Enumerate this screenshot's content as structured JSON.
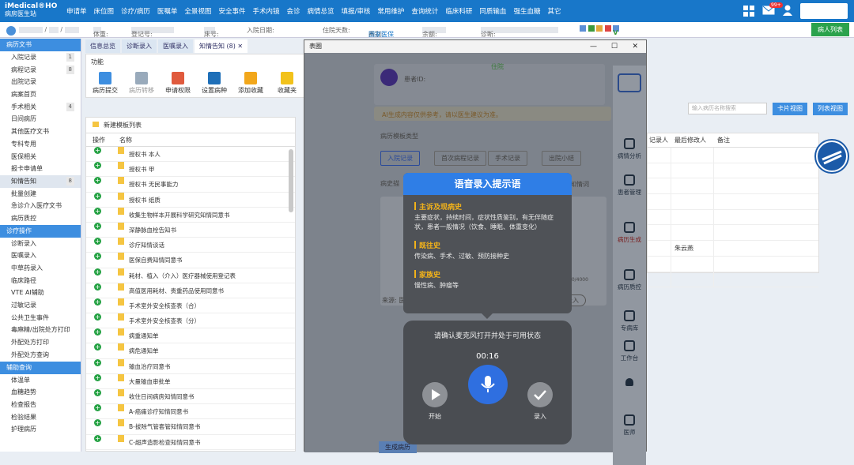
{
  "app": {
    "name_line1": "iMedical",
    "name_suffix": "HO",
    "name_line2": "病房医生站"
  },
  "top_menu": [
    "申请单",
    "床位图",
    "诊疗/病历",
    "医嘱单",
    "全景视图",
    "安全事件",
    "手术内镜",
    "会诊",
    "病情总览",
    "填报/审核",
    "常用维护",
    "查询统计",
    "临床科研",
    "同质输血",
    "强生血糖",
    "其它"
  ],
  "top_icons": {
    "grid": "grid-icon",
    "mail_badge": "99+",
    "user": "user-icon"
  },
  "patient_bar": {
    "weight_label": "体重:",
    "reg_label": "登记号:",
    "bed_label": "床号:",
    "admit_label": "入院日期:",
    "days_label": "住院天数:",
    "fee_label": "费别:",
    "fee_value": "国家医保",
    "balance_label": "余额:",
    "diag_label": "诊断:",
    "list_button": "病人列表"
  },
  "sidebar": {
    "sections": [
      {
        "title": "病历文书",
        "items": [
          {
            "label": "入院记录",
            "count": "1"
          },
          {
            "label": "病程记录",
            "count": "8"
          },
          {
            "label": "出院记录"
          },
          {
            "label": "病案首页"
          },
          {
            "label": "手术相关",
            "count": "4"
          },
          {
            "label": "日间病历"
          },
          {
            "label": "其他医疗文书"
          },
          {
            "label": "专科专用"
          },
          {
            "label": "医保相关"
          },
          {
            "label": "报卡申请单"
          },
          {
            "label": "知情告知",
            "count": "8",
            "active": true
          },
          {
            "label": "批量创建"
          },
          {
            "label": "急诊介入医疗文书"
          },
          {
            "label": "病历质控"
          }
        ]
      },
      {
        "title": "诊疗操作",
        "items": [
          {
            "label": "诊断录入"
          },
          {
            "label": "医嘱录入"
          },
          {
            "label": "中草药录入"
          },
          {
            "label": "临床路径"
          },
          {
            "label": "VTE AI辅助"
          },
          {
            "label": "过敏记录"
          },
          {
            "label": "公共卫生事件"
          },
          {
            "label": "毒麻精/出院处方打印"
          },
          {
            "label": "外配处方打印"
          },
          {
            "label": "外配处方查询"
          }
        ]
      },
      {
        "title": "辅助查询",
        "items": [
          {
            "label": "体温单"
          },
          {
            "label": "血糖趋势"
          },
          {
            "label": "检查报告"
          },
          {
            "label": "检验结果"
          },
          {
            "label": "护理病历"
          }
        ]
      }
    ]
  },
  "tabs": [
    {
      "label": "信息总览"
    },
    {
      "label": "诊断录入"
    },
    {
      "label": "医嘱录入"
    },
    {
      "label": "知情告知 (8)",
      "active": true
    }
  ],
  "toolbar": {
    "section": "功能",
    "buttons": [
      "病历提交",
      "病历转移",
      "申请权限",
      "设置病种",
      "添加收藏",
      "收藏夹"
    ]
  },
  "template_panel": {
    "header": "新建模板列表",
    "col_op": "操作",
    "col_name": "名称",
    "rows": [
      "授权书 本人",
      "授权书 甲",
      "授权书 无民事能力",
      "授权书 纸质",
      "收集生物样本开展科学研究知情同意书",
      "深静脉血栓告知书",
      "诊疗知情谈话",
      "医保自费知情同意书",
      "耗材、植入（介入）医疗器械使用登记表",
      "高值医用耗材、贵重药品使用同意书",
      "手术室外安全核查表（合）",
      "手术室外安全核查表（分）",
      "病重通知单",
      "病危通知单",
      "输血治疗同意书",
      "大量输血审批单",
      "收住日间病房知情同意书",
      "A-癌痛诊疗知情同意书",
      "B-拔除气管套管知情同意书",
      "C-超声造影检查知情同意书"
    ]
  },
  "right_table": {
    "search_placeholder": "输入病历名称搜索",
    "card_view": "卡片视图",
    "list_view": "列表视图",
    "col_recorder": "记录人",
    "col_modifier": "最后修改人",
    "col_remark": "备注",
    "rows": [
      {
        "recorder": "",
        "modifier": ""
      },
      {
        "recorder": "",
        "modifier": ""
      },
      {
        "recorder": "",
        "modifier": ""
      },
      {
        "recorder": "",
        "modifier": ""
      },
      {
        "recorder": "",
        "modifier": ""
      },
      {
        "recorder": "",
        "modifier": ""
      },
      {
        "recorder": "",
        "modifier": "朱云燕"
      },
      {
        "recorder": "",
        "modifier": ""
      },
      {
        "recorder": "",
        "modifier": ""
      }
    ]
  },
  "window": {
    "title": "表圈",
    "ctrl_min": "—",
    "ctrl_max": "☐",
    "ctrl_close": "✕",
    "status": "住院",
    "patient_id_label": "患者ID:",
    "notice": "AI生成内容仅供参考，请以医生建议为准。",
    "template_type_label": "病历模板类型",
    "template_tabs": [
      "入院记录",
      "首次病程记录",
      "手术记录",
      "出院小结"
    ],
    "history_label": "病史描",
    "ref_label": "知情词",
    "source_label": "来源:",
    "source_value": "医师",
    "counter": "10/4000",
    "voice_button": "语音录入",
    "generate_button": "生成病历",
    "side_items": [
      "病情分析",
      "患者管理",
      "病历生成",
      "病历质控",
      "专病库",
      "工作台",
      "通知",
      "医师"
    ]
  },
  "hint": {
    "title": "语音录入提示语",
    "sections": [
      {
        "title": "主诉及现病史",
        "desc": "主要症状，持续时间，症状性质鉴别，有无伴随症状，患者一般情况（饮食、睡眠、体重变化）"
      },
      {
        "title": "既往史",
        "desc": "传染病、手术、过敏、预防接种史"
      },
      {
        "title": "家族史",
        "desc": "慢性病、肿瘤等"
      }
    ]
  },
  "recorder": {
    "prompt": "请确认麦克风打开并处于可用状态",
    "timer": "00:16",
    "start_label": "开始",
    "record_label": "录入"
  }
}
